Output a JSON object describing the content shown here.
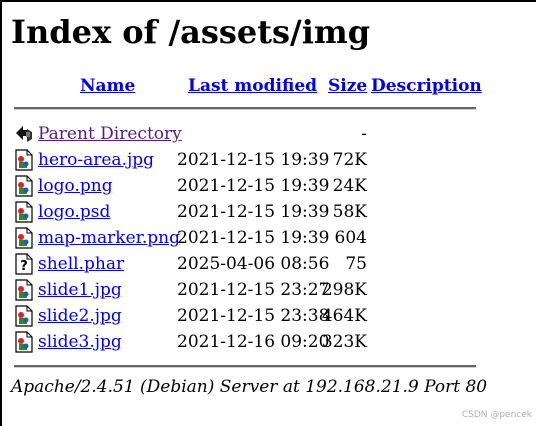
{
  "page": {
    "title": "Index of /assets/img",
    "server_signature": "Apache/2.4.51 (Debian) Server at 192.168.21.9 Port 80",
    "watermark": "CSDN @pencek"
  },
  "columns": {
    "name": "Name",
    "last_modified": "Last modified",
    "size": "Size",
    "description": "Description"
  },
  "parent": {
    "label": "Parent Directory",
    "size": "-",
    "icon": "back-icon"
  },
  "rows": [
    {
      "name": "hero-area.jpg",
      "modified": "2021-12-15 19:39",
      "size": "72K",
      "icon": "image-icon"
    },
    {
      "name": "logo.png",
      "modified": "2021-12-15 19:39",
      "size": "24K",
      "icon": "image-icon"
    },
    {
      "name": "logo.psd",
      "modified": "2021-12-15 19:39",
      "size": "58K",
      "icon": "image-icon"
    },
    {
      "name": "map-marker.png",
      "modified": "2021-12-15 19:39",
      "size": "604",
      "icon": "image-icon"
    },
    {
      "name": "shell.phar",
      "modified": "2025-04-06 08:56",
      "size": "75",
      "icon": "unknown-file-icon"
    },
    {
      "name": "slide1.jpg",
      "modified": "2021-12-15 23:27",
      "size": "298K",
      "icon": "image-icon"
    },
    {
      "name": "slide2.jpg",
      "modified": "2021-12-15 23:38",
      "size": "464K",
      "icon": "image-icon"
    },
    {
      "name": "slide3.jpg",
      "modified": "2021-12-16 09:20",
      "size": "323K",
      "icon": "image-icon"
    }
  ],
  "colors": {
    "link": "#0000ee",
    "visited_link": "#551a8b"
  }
}
